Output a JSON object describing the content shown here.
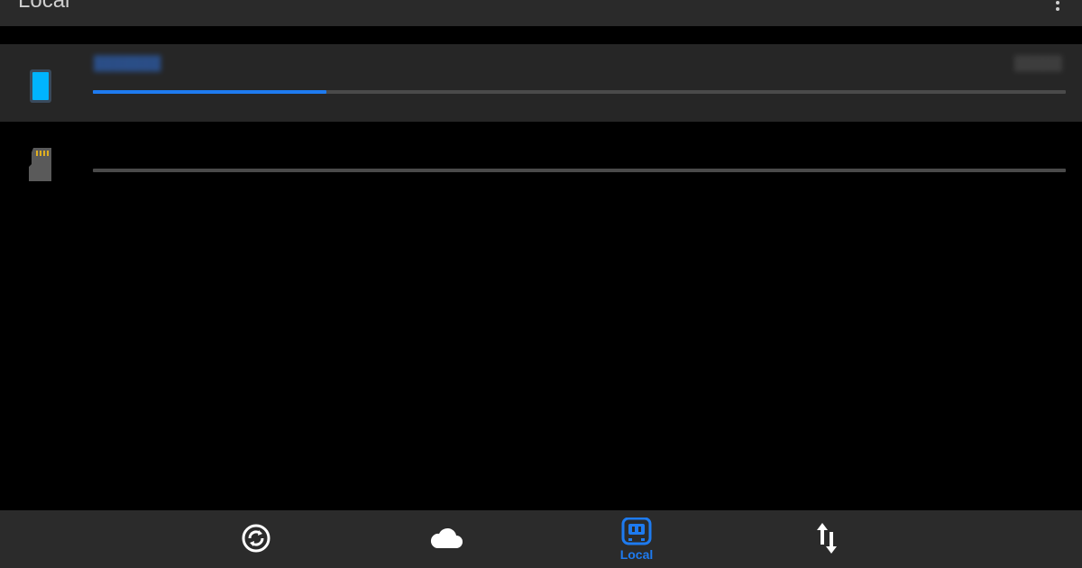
{
  "header": {
    "title": "Local",
    "overflow_icon": "more-vert-icon"
  },
  "storage": [
    {
      "id": "internal",
      "icon": "phone-icon",
      "used_fraction": 0.24,
      "selected": true
    },
    {
      "id": "sdcard",
      "icon": "sd-card-icon",
      "used_fraction": 0.0,
      "selected": false
    }
  ],
  "bottom_nav": {
    "items": [
      {
        "id": "sync",
        "icon": "sync-icon",
        "label": ""
      },
      {
        "id": "cloud",
        "icon": "cloud-icon",
        "label": ""
      },
      {
        "id": "local",
        "icon": "local-storage-icon",
        "label": "Local",
        "active": true
      },
      {
        "id": "transfers",
        "icon": "transfer-arrows-icon",
        "label": ""
      }
    ]
  },
  "colors": {
    "accent": "#1e7bf0",
    "phone_screen": "#00b4ff",
    "bar_track": "#4a4a4a",
    "app_bar": "#2a2a2a",
    "selected_row": "#262626",
    "background": "#000000"
  }
}
